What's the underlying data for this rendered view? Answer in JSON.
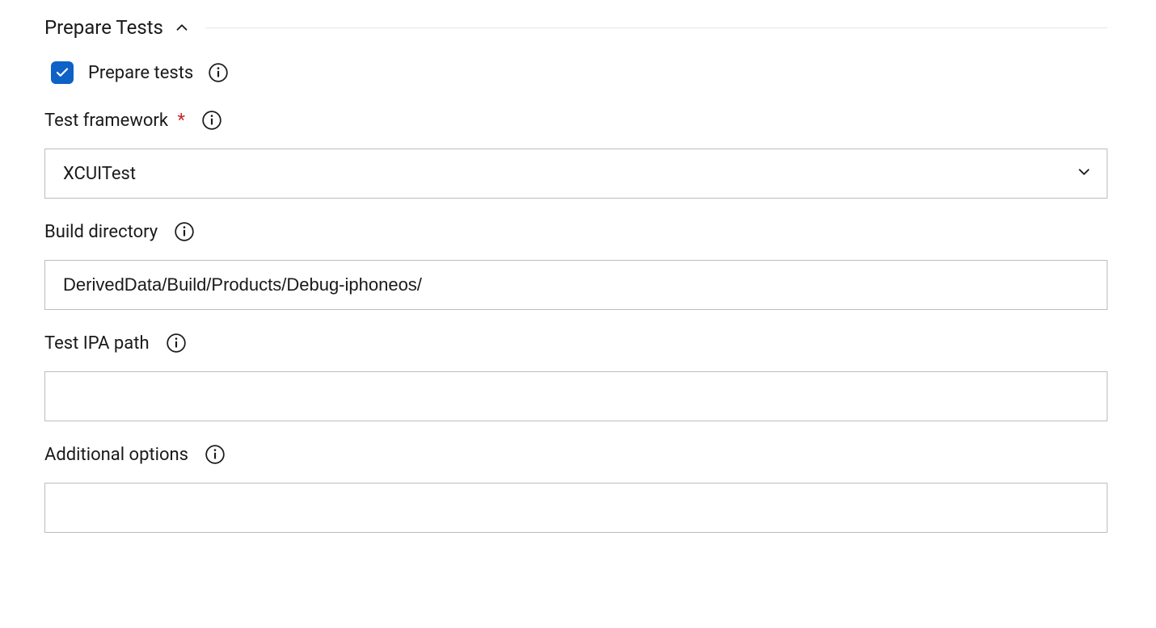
{
  "section": {
    "title": "Prepare Tests"
  },
  "fields": {
    "prepare_tests": {
      "label": "Prepare tests",
      "checked": true
    },
    "test_framework": {
      "label": "Test framework",
      "required": true,
      "value": "XCUITest"
    },
    "build_directory": {
      "label": "Build directory",
      "value": "DerivedData/Build/Products/Debug-iphoneos/"
    },
    "test_ipa_path": {
      "label": "Test IPA path",
      "value": ""
    },
    "additional_options": {
      "label": "Additional options",
      "value": ""
    }
  }
}
